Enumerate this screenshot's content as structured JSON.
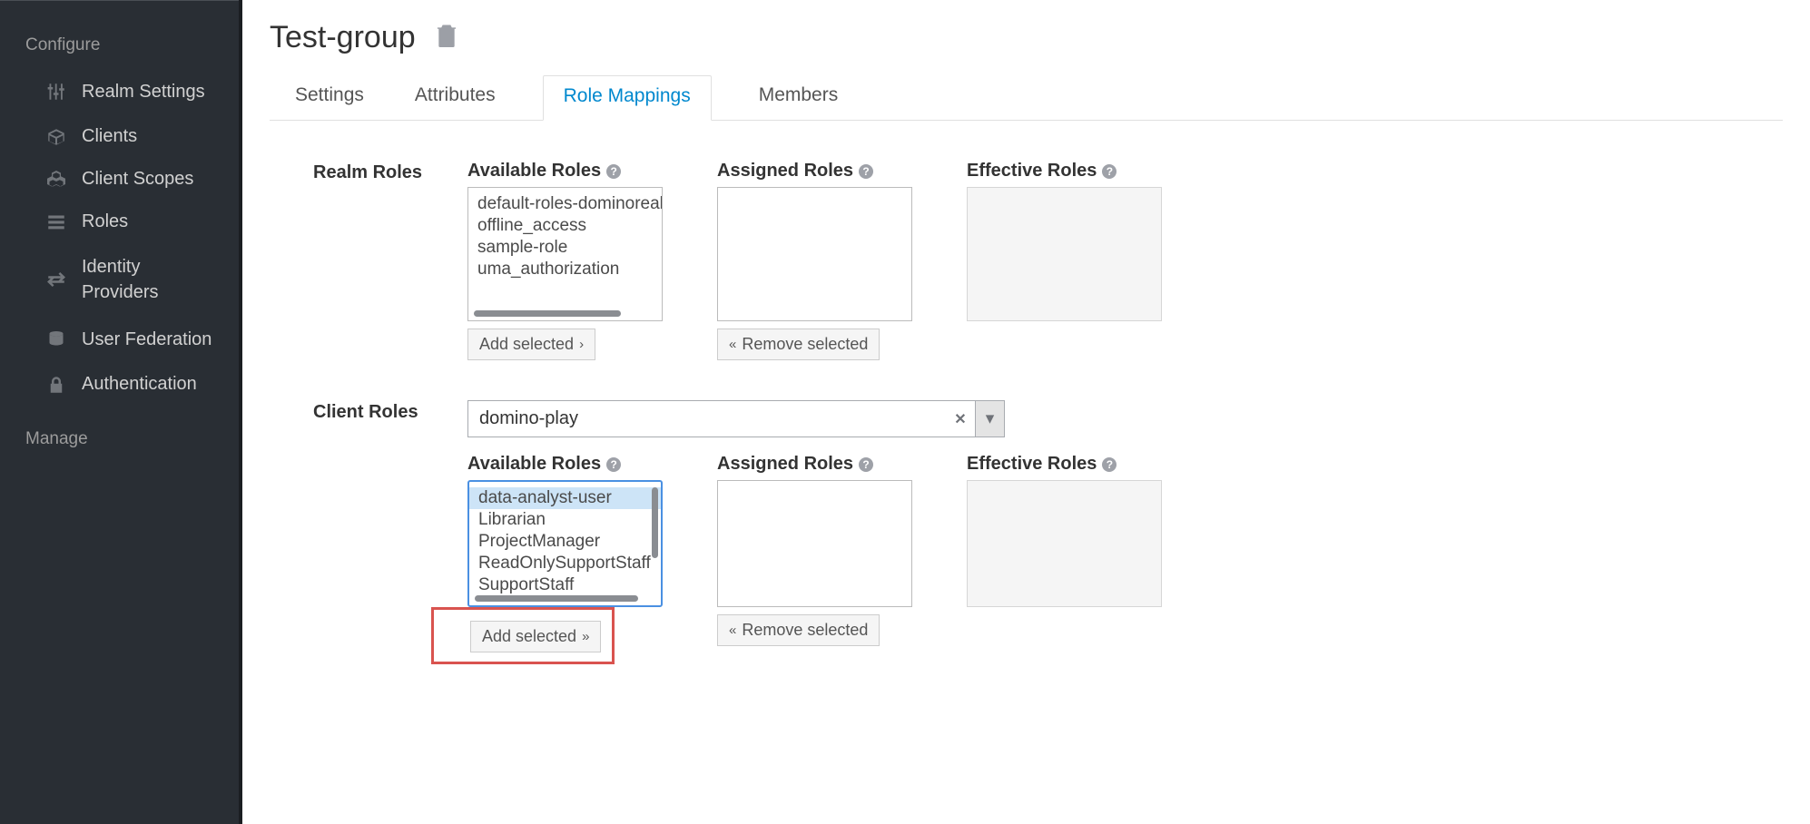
{
  "sidebar": {
    "section_configure": "Configure",
    "items": [
      "Realm Settings",
      "Clients",
      "Client Scopes",
      "Roles",
      "Identity Providers",
      "User Federation",
      "Authentication"
    ],
    "section_manage": "Manage"
  },
  "page": {
    "title": "Test-group",
    "tabs": {
      "settings": "Settings",
      "attributes": "Attributes",
      "role_mappings": "Role Mappings",
      "members": "Members"
    }
  },
  "realm_roles": {
    "label": "Realm Roles",
    "available_label": "Available Roles",
    "assigned_label": "Assigned Roles",
    "effective_label": "Effective Roles",
    "available": [
      "default-roles-dominorealm",
      "offline_access",
      "sample-role",
      "uma_authorization"
    ],
    "add_btn": "Add selected",
    "remove_btn": "Remove selected"
  },
  "client_roles": {
    "label": "Client Roles",
    "selected_client": "domino-play",
    "available_label": "Available Roles",
    "assigned_label": "Assigned Roles",
    "effective_label": "Effective Roles",
    "available": [
      "data-analyst-user",
      "Librarian",
      "ProjectManager",
      "ReadOnlySupportStaff",
      "SupportStaff"
    ],
    "selected_index": 0,
    "add_btn": "Add selected",
    "remove_btn": "Remove selected"
  }
}
